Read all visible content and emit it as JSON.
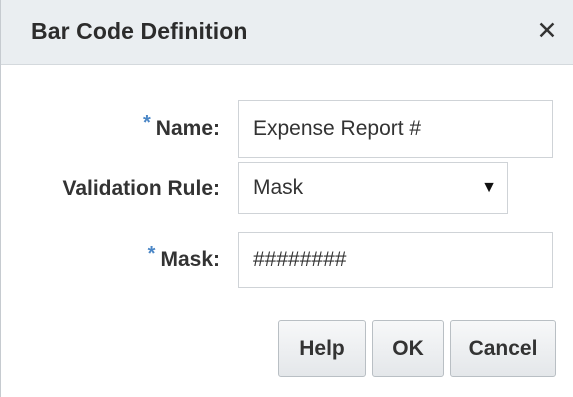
{
  "dialog": {
    "title": "Bar Code Definition",
    "close_glyph": "✕"
  },
  "form": {
    "required_mark": "*",
    "name_label": "Name:",
    "name_value": "Expense Report #",
    "validation_label": "Validation Rule:",
    "validation_value": "Mask",
    "validation_arrow": "▼",
    "mask_label": "Mask:",
    "mask_value": "########"
  },
  "buttons": {
    "help": "Help",
    "ok": "OK",
    "cancel": "Cancel"
  },
  "colors": {
    "titlebar_bg": "#eaeef1",
    "required_accent": "#4a86c6",
    "field_border": "#cfd3d7"
  }
}
